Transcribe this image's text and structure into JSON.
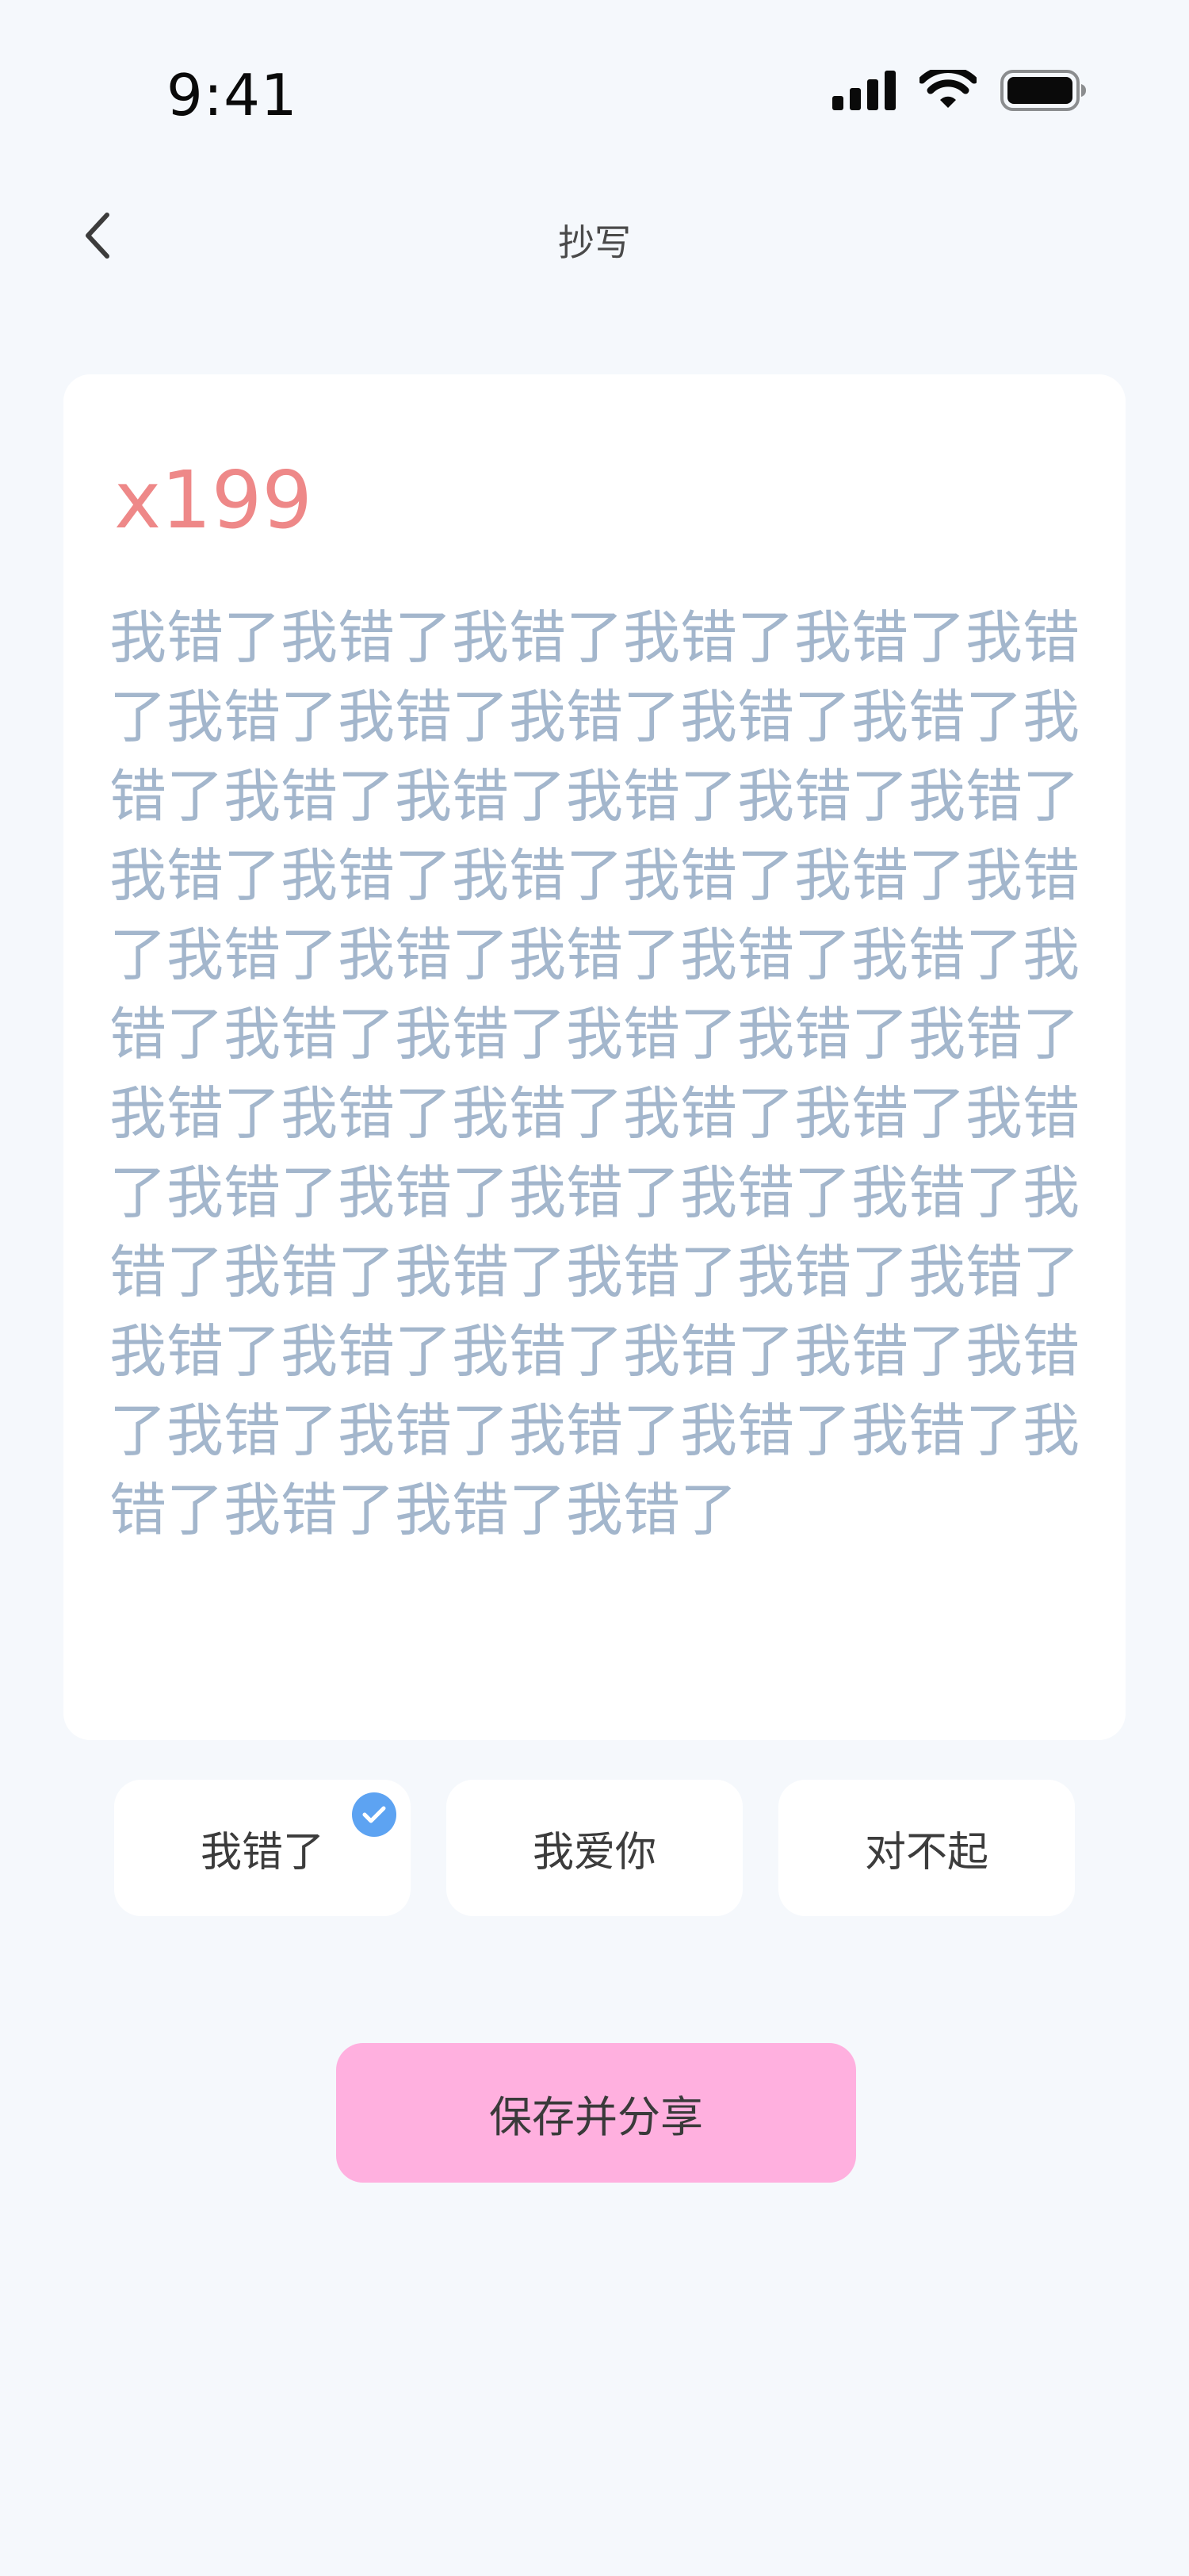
{
  "status_bar": {
    "time": "9:41",
    "icons": [
      "signal-icon",
      "wifi-icon",
      "battery-icon"
    ]
  },
  "nav": {
    "back_icon": "chevron-left-icon",
    "title": "抄写"
  },
  "card": {
    "count": "x199",
    "text": "我错了我错了我错了我错了我错了我错了我错了我错了我错了我错了我错了我错了我错了我错了我错了我错了我错了我错了我错了我错了我错了我错了我错了我错了我错了我错了我错了我错了我错了我错了我错了我错了我错了我错了我错了我错了我错了我错了我错了我错了我错了我错了我错了我错了我错了我错了我错了我错了我错了我错了我错了我错了我错了我错了我错了我错了我错了我错了我错了我错了我错了我错了我错了我错了我错了我错了"
  },
  "options": [
    {
      "label": "我错了",
      "selected": true
    },
    {
      "label": "我爱你",
      "selected": false
    },
    {
      "label": "对不起",
      "selected": false
    }
  ],
  "save_button": {
    "label": "保存并分享"
  },
  "colors": {
    "background": "#F5F8FC",
    "count": "#EE8888",
    "copy_text": "#A3B6CC",
    "check_badge": "#5DA3F2",
    "save_button": "#FFB0DF"
  }
}
